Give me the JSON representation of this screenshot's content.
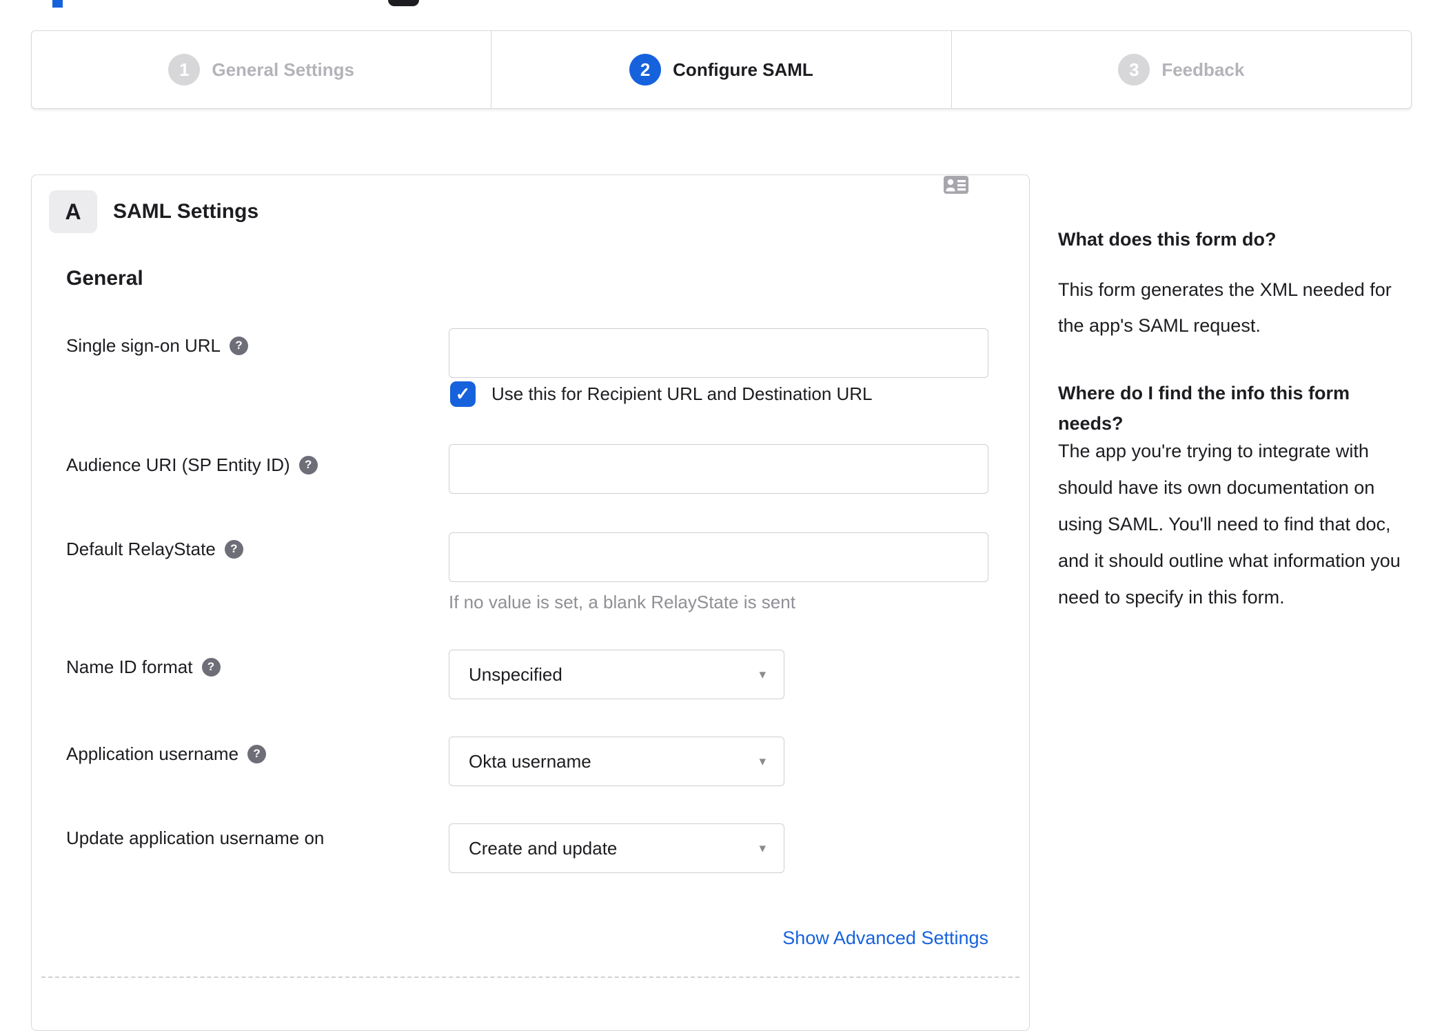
{
  "colors": {
    "accent_blue": "#1662dd",
    "inactive_gray": "#d7d7da",
    "text": "#1d1d21",
    "hint_gray": "#8f8f96"
  },
  "icons": {
    "help": "?",
    "check": "✓",
    "caret": "▾",
    "contact_card": "contact-card"
  },
  "stepper": {
    "steps": [
      {
        "number": "1",
        "label": "General Settings",
        "active": false
      },
      {
        "number": "2",
        "label": "Configure SAML",
        "active": true
      },
      {
        "number": "3",
        "label": "Feedback",
        "active": false
      }
    ]
  },
  "form": {
    "badge": "A",
    "title": "SAML Settings",
    "section": "General",
    "sso": {
      "label": "Single sign-on URL",
      "value": "",
      "checkbox_label": "Use this for Recipient URL and Destination URL",
      "checkbox_checked": true
    },
    "audience": {
      "label": "Audience URI (SP Entity ID)",
      "value": ""
    },
    "relay": {
      "label": "Default RelayState",
      "value": "",
      "hint": "If no value is set, a blank RelayState is sent"
    },
    "name_id": {
      "label": "Name ID format",
      "value": "Unspecified"
    },
    "app_username": {
      "label": "Application username",
      "value": "Okta username"
    },
    "update_username": {
      "label": "Update application username on",
      "value": "Create and update"
    },
    "advanced_link": "Show Advanced Settings"
  },
  "sidebar": {
    "q1": "What does this form do?",
    "a1": "This form generates the XML needed for the app's SAML request.",
    "q2": "Where do I find the info this form needs?",
    "a2": "The app you're trying to integrate with should have its own documentation on using SAML. You'll need to find that doc, and it should outline what information you need to specify in this form."
  }
}
